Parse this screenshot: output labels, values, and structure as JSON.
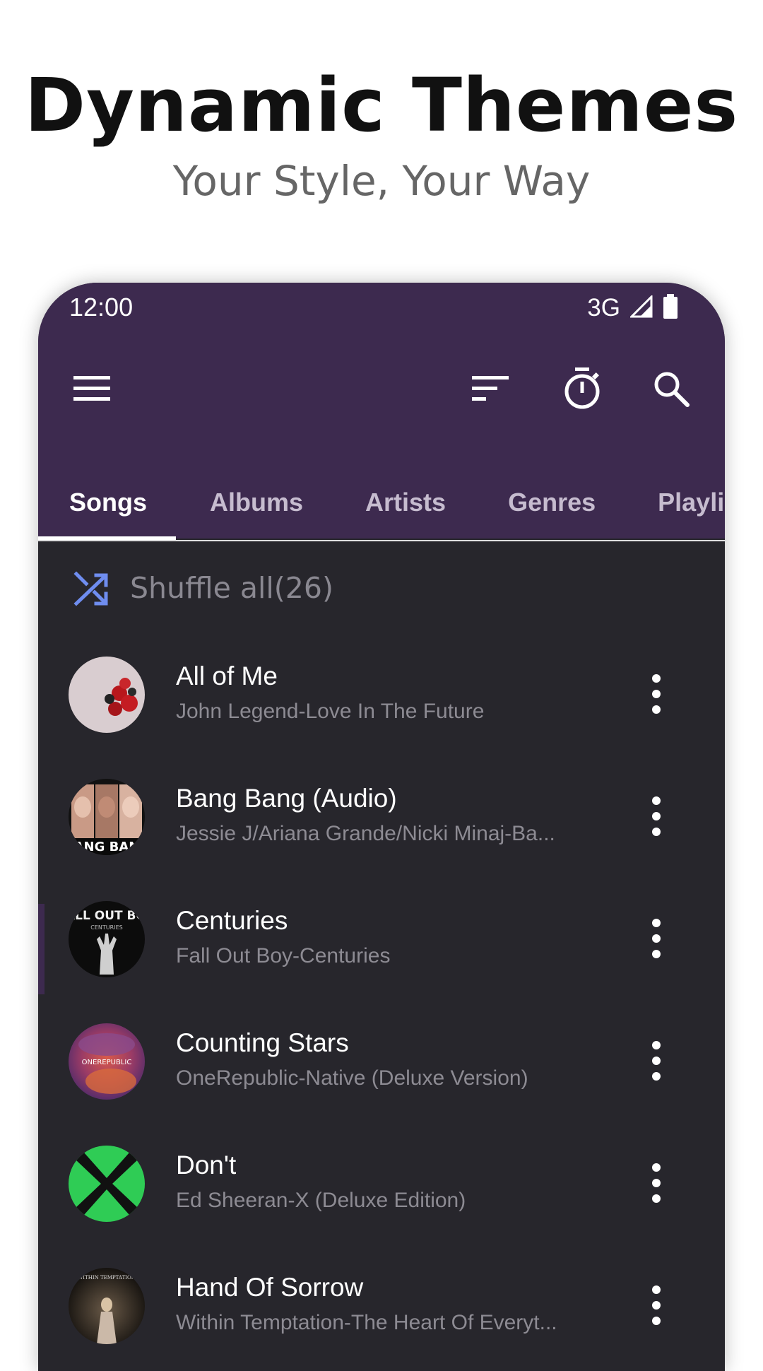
{
  "promo": {
    "title": "Dynamic Themes",
    "subtitle": "Your Style, Your Way"
  },
  "status_bar": {
    "time": "12:00",
    "network": "3G"
  },
  "toolbar": {
    "icons": [
      "menu-icon",
      "sort-icon",
      "timer-icon",
      "search-icon"
    ]
  },
  "tabs": [
    {
      "label": "Songs",
      "active": true
    },
    {
      "label": "Albums"
    },
    {
      "label": "Artists"
    },
    {
      "label": "Genres"
    },
    {
      "label": "Playlis"
    }
  ],
  "shuffle": {
    "label": "Shuffle all(26)"
  },
  "songs": [
    {
      "title": "All of Me",
      "subtitle": "John Legend-Love In The Future"
    },
    {
      "title": "Bang Bang (Audio)",
      "subtitle": "Jessie J/Ariana Grande/Nicki Minaj-Ba..."
    },
    {
      "title": "Centuries",
      "subtitle": "Fall Out Boy-Centuries",
      "album_art_text": "FALL OUT BOY"
    },
    {
      "title": "Counting Stars",
      "subtitle": "OneRepublic-Native (Deluxe Version)"
    },
    {
      "title": "Don't",
      "subtitle": "Ed Sheeran-X (Deluxe Edition)"
    },
    {
      "title": "Hand Of Sorrow",
      "subtitle": "Within Temptation-The Heart Of Everyt..."
    }
  ],
  "colors": {
    "header": "#3d2a4f",
    "list_bg": "#27262c",
    "accent": "#6f8df0"
  }
}
